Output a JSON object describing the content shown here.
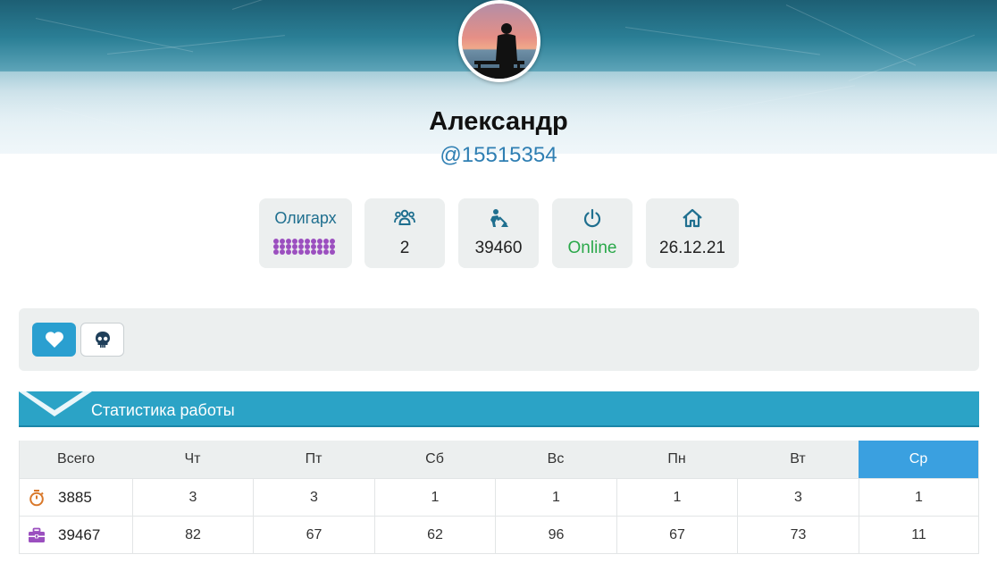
{
  "profile": {
    "name": "Александр",
    "handle": "@15515354"
  },
  "stats": [
    {
      "key": "rank",
      "label": "Олигарх",
      "rank_level": 30
    },
    {
      "key": "friends",
      "icon": "users-icon",
      "value": "2"
    },
    {
      "key": "work",
      "icon": "worker-icon",
      "value": "39460"
    },
    {
      "key": "status",
      "icon": "power-icon",
      "value": "Online"
    },
    {
      "key": "registered",
      "icon": "home-icon",
      "value": "26.12.21"
    }
  ],
  "toolbar": {
    "like_icon": "heart-icon",
    "skull_icon": "skull-icon"
  },
  "section": {
    "title": "Статистика работы"
  },
  "table": {
    "headers": [
      "Всего",
      "Чт",
      "Пт",
      "Сб",
      "Вс",
      "Пн",
      "Вт",
      "Ср"
    ],
    "active_header": "Ср",
    "rows": [
      {
        "icon": "stopwatch-icon",
        "total": "3885",
        "values": [
          "3",
          "3",
          "1",
          "1",
          "1",
          "3",
          "1"
        ]
      },
      {
        "icon": "briefcase-icon",
        "total": "39467",
        "values": [
          "82",
          "67",
          "62",
          "96",
          "67",
          "73",
          "11"
        ]
      }
    ]
  },
  "colors": {
    "accent": "#2ba3c6",
    "handle": "#2f7fb3",
    "online": "#2aa84a",
    "rank_dots": "#9b4fbf",
    "active_day": "#3aa0e0"
  }
}
